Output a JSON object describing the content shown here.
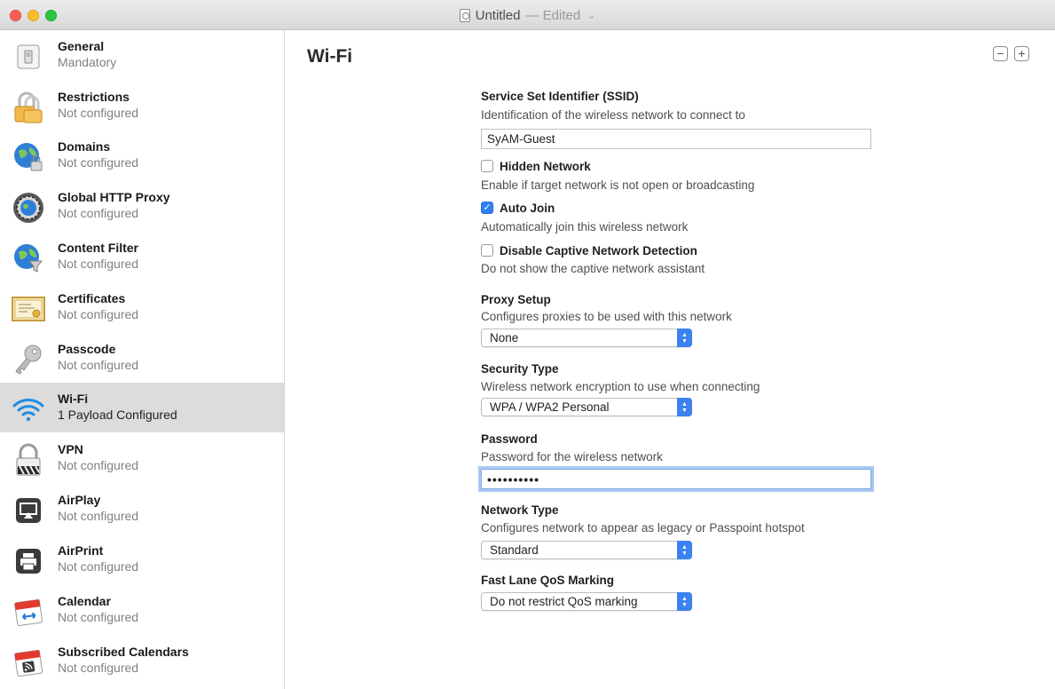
{
  "window": {
    "title": "Untitled",
    "status": "— Edited",
    "status_chevron": "⌄"
  },
  "sidebar": {
    "items": [
      {
        "title": "General",
        "subtitle": "Mandatory",
        "icon": "general-switch-icon"
      },
      {
        "title": "Restrictions",
        "subtitle": "Not configured",
        "icon": "padlock-icon"
      },
      {
        "title": "Domains",
        "subtitle": "Not configured",
        "icon": "globe-lock-icon"
      },
      {
        "title": "Global HTTP Proxy",
        "subtitle": "Not configured",
        "icon": "proxy-globe-icon"
      },
      {
        "title": "Content Filter",
        "subtitle": "Not configured",
        "icon": "globe-filter-icon"
      },
      {
        "title": "Certificates",
        "subtitle": "Not configured",
        "icon": "certificate-icon"
      },
      {
        "title": "Passcode",
        "subtitle": "Not configured",
        "icon": "key-icon"
      },
      {
        "title": "Wi-Fi",
        "subtitle": "1 Payload Configured",
        "icon": "wifi-icon",
        "selected": true
      },
      {
        "title": "VPN",
        "subtitle": "Not configured",
        "icon": "vpn-lock-icon"
      },
      {
        "title": "AirPlay",
        "subtitle": "Not configured",
        "icon": "airplay-icon"
      },
      {
        "title": "AirPrint",
        "subtitle": "Not configured",
        "icon": "printer-icon"
      },
      {
        "title": "Calendar",
        "subtitle": "Not configured",
        "icon": "calendar-icon"
      },
      {
        "title": "Subscribed Calendars",
        "subtitle": "Not configured",
        "icon": "subscribed-calendar-icon"
      }
    ]
  },
  "main": {
    "title": "Wi-Fi",
    "remove_label": "−",
    "add_label": "+",
    "ssid": {
      "label": "Service Set Identifier (SSID)",
      "description": "Identification of the wireless network to connect to",
      "value": "SyAM-Guest"
    },
    "hidden_network": {
      "label": "Hidden Network",
      "description": "Enable if target network is not open or broadcasting",
      "checked": false
    },
    "auto_join": {
      "label": "Auto Join",
      "description": "Automatically join this wireless network",
      "checked": true,
      "check_glyph": "✓"
    },
    "captive": {
      "label": "Disable Captive Network Detection",
      "description": "Do not show the captive network assistant",
      "checked": false
    },
    "proxy_setup": {
      "label": "Proxy Setup",
      "description": "Configures proxies to be used with this network",
      "value": "None"
    },
    "security_type": {
      "label": "Security Type",
      "description": "Wireless network encryption to use when connecting",
      "value": "WPA / WPA2 Personal"
    },
    "password": {
      "label": "Password",
      "description": "Password for the wireless network",
      "value": "••••••••••"
    },
    "network_type": {
      "label": "Network Type",
      "description": "Configures network to appear as legacy or Passpoint hotspot",
      "value": "Standard"
    },
    "fast_lane": {
      "label": "Fast Lane QoS Marking",
      "value": "Do not restrict QoS marking"
    }
  },
  "colors": {
    "accent": "#3b82f0",
    "selection": "#dcdcdc",
    "close": "#fc5f57",
    "minimize": "#fdbc2e",
    "zoom": "#2ac840"
  }
}
